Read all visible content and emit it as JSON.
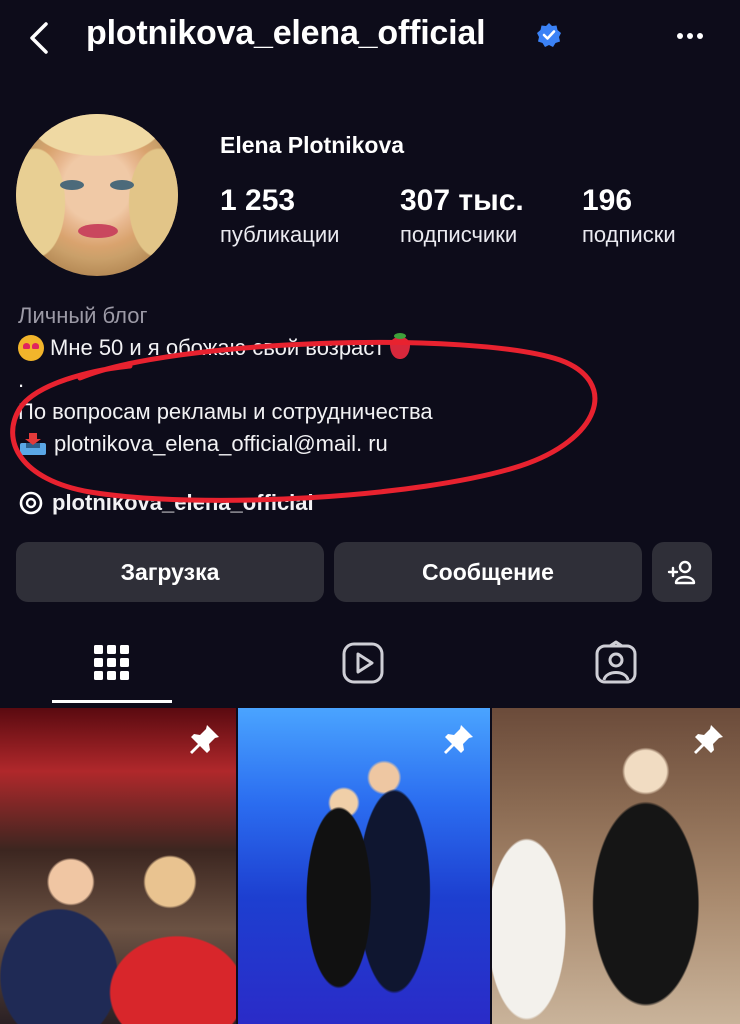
{
  "header": {
    "username": "plotnikova_elena_official",
    "icons": [
      "back-arrow-icon",
      "verified-badge-icon",
      "more-options-icon"
    ]
  },
  "profile": {
    "full_name": "Elena Plotnikova",
    "stats": [
      {
        "value": "1 253",
        "label": "публикации"
      },
      {
        "value": "307 тыс.",
        "label": "подписчики"
      },
      {
        "value": "196",
        "label": "подписки"
      }
    ]
  },
  "bio": {
    "category": "Личный блог",
    "line1": "Мне 50 и я обожаю свой возраст",
    "line2": ".",
    "line3": "По вопросам рекламы и сотрудничества",
    "email": "plotnikova_elena_official@mail. ru",
    "threads_handle": "plotnikova_elena_official"
  },
  "actions": {
    "primary_label": "Загрузка",
    "message_label": "Сообщение",
    "add_friend_icon": "add-person-icon"
  },
  "tabs": [
    "grid-icon",
    "reels-icon",
    "tagged-icon"
  ],
  "colors": {
    "background": "#0d0c1a",
    "button": "#2f2f38",
    "verified": "#3b82f6",
    "annotation_circle": "#e8222f"
  }
}
